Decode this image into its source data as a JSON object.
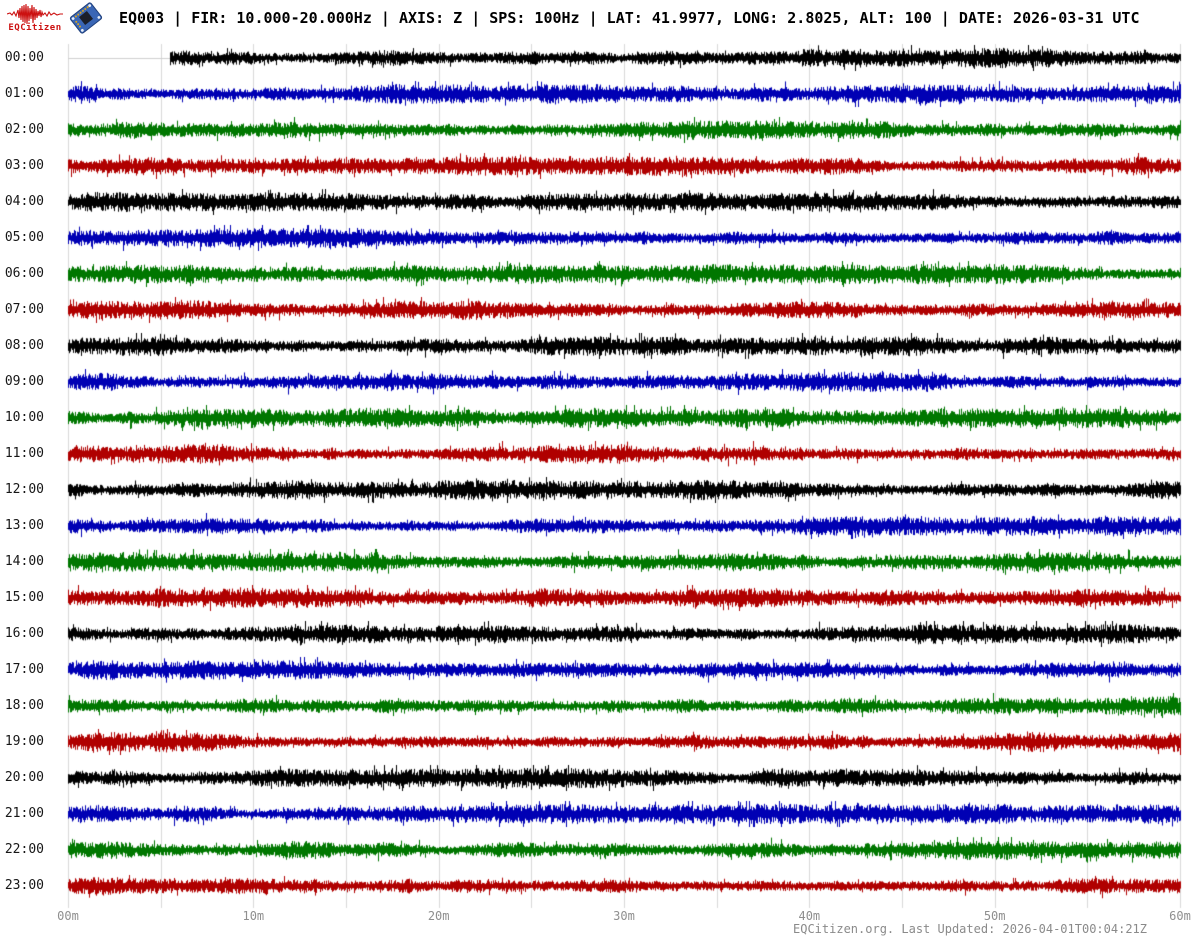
{
  "header": {
    "logo_text": "EQCitizen",
    "logo_color": "#cc1111",
    "title": "EQ003 | FIR: 10.000-20.000Hz | AXIS: Z | SPS: 100Hz | LAT: 41.9977, LONG: 2.8025, ALT: 100 | DATE: 2026-03-31 UTC",
    "station": "EQ003",
    "filter": "10.000-20.000Hz",
    "axis": "Z",
    "sps": "100Hz",
    "lat": "41.9977",
    "long": "2.8025",
    "alt": "100",
    "date": "2026-03-31 UTC"
  },
  "footer": {
    "text": "EQCitizen.org. Last Updated: 2026-04-01T00:04:21Z"
  },
  "colors": {
    "background": "#ffffff",
    "grid": "#d9d9d9",
    "baseline": "#cfcfcf",
    "tick": "#c2c2c2",
    "axis_label_text": "#8f8f8f",
    "time_label_text": "#161616",
    "title_text": "#000000",
    "footer_text": "#8a8a8a",
    "logo_red": "#cc1111"
  },
  "chart_data": {
    "type": "line",
    "subtype": "helicorder_seismogram_24h",
    "title": "EQ003 | FIR: 10.000-20.000Hz | AXIS: Z | SPS: 100Hz | LAT: 41.9977, LONG: 2.8025, ALT: 100 | DATE: 2026-03-31 UTC",
    "xlabel": "",
    "ylabel": "",
    "x_axis": {
      "unit": "minutes",
      "range": [
        0,
        60
      ],
      "tick_labels": [
        "00m",
        "10m",
        "20m",
        "30m",
        "40m",
        "50m",
        "60m"
      ],
      "major_tick_step_min": 10,
      "minor_tick_step_min": 5
    },
    "grid": {
      "vertical_lines_every_min": 5,
      "horizontal_lines": false
    },
    "legend": null,
    "trace_color_cycle": [
      "#000000",
      "#0000b4",
      "#007700",
      "#b00000"
    ],
    "description": "24 hourly rows of continuous band-limited seismic noise; no large distinct events; first row data begins ~5.5 minutes into the hour",
    "rows": [
      {
        "label": "00:00",
        "color": "#000000",
        "start_minute": 5.5,
        "end_minute": 60
      },
      {
        "label": "01:00",
        "color": "#0000b4",
        "start_minute": 0,
        "end_minute": 60
      },
      {
        "label": "02:00",
        "color": "#007700",
        "start_minute": 0,
        "end_minute": 60
      },
      {
        "label": "03:00",
        "color": "#b00000",
        "start_minute": 0,
        "end_minute": 60
      },
      {
        "label": "04:00",
        "color": "#000000",
        "start_minute": 0,
        "end_minute": 60
      },
      {
        "label": "05:00",
        "color": "#0000b4",
        "start_minute": 0,
        "end_minute": 60
      },
      {
        "label": "06:00",
        "color": "#007700",
        "start_minute": 0,
        "end_minute": 60
      },
      {
        "label": "07:00",
        "color": "#b00000",
        "start_minute": 0,
        "end_minute": 60
      },
      {
        "label": "08:00",
        "color": "#000000",
        "start_minute": 0,
        "end_minute": 60
      },
      {
        "label": "09:00",
        "color": "#0000b4",
        "start_minute": 0,
        "end_minute": 60
      },
      {
        "label": "10:00",
        "color": "#007700",
        "start_minute": 0,
        "end_minute": 60
      },
      {
        "label": "11:00",
        "color": "#b00000",
        "start_minute": 0,
        "end_minute": 60
      },
      {
        "label": "12:00",
        "color": "#000000",
        "start_minute": 0,
        "end_minute": 60
      },
      {
        "label": "13:00",
        "color": "#0000b4",
        "start_minute": 0,
        "end_minute": 60
      },
      {
        "label": "14:00",
        "color": "#007700",
        "start_minute": 0,
        "end_minute": 60
      },
      {
        "label": "15:00",
        "color": "#b00000",
        "start_minute": 0,
        "end_minute": 60
      },
      {
        "label": "16:00",
        "color": "#000000",
        "start_minute": 0,
        "end_minute": 60
      },
      {
        "label": "17:00",
        "color": "#0000b4",
        "start_minute": 0,
        "end_minute": 60
      },
      {
        "label": "18:00",
        "color": "#007700",
        "start_minute": 0,
        "end_minute": 60
      },
      {
        "label": "19:00",
        "color": "#b00000",
        "start_minute": 0,
        "end_minute": 60
      },
      {
        "label": "20:00",
        "color": "#000000",
        "start_minute": 0,
        "end_minute": 60
      },
      {
        "label": "21:00",
        "color": "#0000b4",
        "start_minute": 0,
        "end_minute": 60
      },
      {
        "label": "22:00",
        "color": "#007700",
        "start_minute": 0,
        "end_minute": 60
      },
      {
        "label": "23:00",
        "color": "#b00000",
        "start_minute": 0,
        "end_minute": 60
      }
    ]
  }
}
